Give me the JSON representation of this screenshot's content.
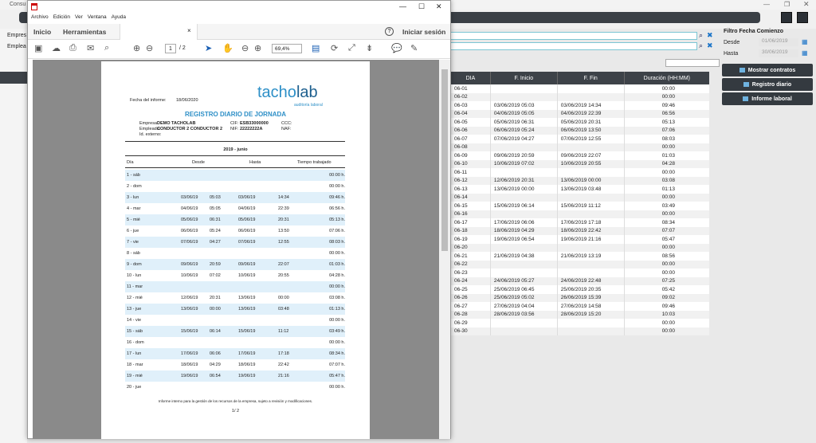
{
  "bg": {
    "title": "Consu",
    "label_empresa": "Empres",
    "label_empleado": "Emplea",
    "filter_title": "Filtro Fecha Comienzo",
    "desde_label": "Desde",
    "desde_value": "01/06/2019",
    "hasta_label": "Hasta",
    "hasta_value": "30/06/2019",
    "buttons": [
      "Mostrar contratos",
      "Registro diario",
      "Informe laboral"
    ],
    "grid_headers": [
      "DIA",
      "F. Inicio",
      "F. Fin",
      "Duración (HH:MM)"
    ],
    "grid_rows": [
      [
        "06-01",
        "",
        "",
        "00:00"
      ],
      [
        "06-02",
        "",
        "",
        "00:00"
      ],
      [
        "06-03",
        "03/06/2019 05:03",
        "03/06/2019 14:34",
        "09:46"
      ],
      [
        "06-04",
        "04/06/2019 05:05",
        "04/06/2019 22:39",
        "06:56"
      ],
      [
        "06-05",
        "05/06/2019 06:31",
        "05/06/2019 20:31",
        "05:13"
      ],
      [
        "06-06",
        "06/06/2019 05:24",
        "06/06/2019 13:50",
        "07:06"
      ],
      [
        "06-07",
        "07/06/2019 04:27",
        "07/06/2019 12:55",
        "08:03"
      ],
      [
        "06-08",
        "",
        "",
        "00:00"
      ],
      [
        "06-09",
        "09/06/2019 20:59",
        "09/06/2019 22:07",
        "01:03"
      ],
      [
        "06-10",
        "10/06/2019 07:02",
        "10/06/2019 20:55",
        "04:28"
      ],
      [
        "06-11",
        "",
        "",
        "00:00"
      ],
      [
        "06-12",
        "12/06/2019 20:31",
        "13/06/2019 00:00",
        "03:08"
      ],
      [
        "06-13",
        "13/06/2019 00:00",
        "13/06/2019 03:48",
        "01:13"
      ],
      [
        "06-14",
        "",
        "",
        "00:00"
      ],
      [
        "06-15",
        "15/06/2019 06:14",
        "15/06/2019 11:12",
        "03:49"
      ],
      [
        "06-16",
        "",
        "",
        "00:00"
      ],
      [
        "06-17",
        "17/06/2019 06:06",
        "17/06/2019 17:18",
        "08:34"
      ],
      [
        "06-18",
        "18/06/2019 04:29",
        "18/06/2019 22:42",
        "07:07"
      ],
      [
        "06-19",
        "19/06/2019 06:54",
        "19/06/2019 21:16",
        "05:47"
      ],
      [
        "06-20",
        "",
        "",
        "00:00"
      ],
      [
        "06-21",
        "21/06/2019 04:38",
        "21/06/2019 13:19",
        "08:56"
      ],
      [
        "06-22",
        "",
        "",
        "00:00"
      ],
      [
        "06-23",
        "",
        "",
        "00:00"
      ],
      [
        "06-24",
        "24/06/2019 05:27",
        "24/06/2019 22:48",
        "07:25"
      ],
      [
        "06-25",
        "25/06/2019 06:45",
        "25/06/2019 20:35",
        "05:42"
      ],
      [
        "06-26",
        "25/06/2019 05:02",
        "26/06/2019 15:39",
        "09:02"
      ],
      [
        "06-27",
        "27/06/2019 04:04",
        "27/06/2019 14:58",
        "09:46"
      ],
      [
        "06-28",
        "28/06/2019 03:56",
        "28/06/2019 15:20",
        "10:03"
      ],
      [
        "06-29",
        "",
        "",
        "00:00"
      ],
      [
        "06-30",
        "",
        "",
        "00:00"
      ]
    ]
  },
  "pdf": {
    "menu": [
      "Archivo",
      "Edición",
      "Ver",
      "Ventana",
      "Ayuda"
    ],
    "tabs": [
      "Inicio",
      "Herramientas"
    ],
    "signin": "Iniciar sesión",
    "page_current": "1",
    "page_total": "/ 2",
    "zoom": "69,4%",
    "doc": {
      "fecha_label": "Fecha del informe:",
      "fecha_value": "18/06/2020",
      "logo_a": "tacho",
      "logo_b": "lab",
      "logo_sub": "auditoría laboral",
      "title": "REGISTRO DIARIO DE JORNADA",
      "empresa_label": "Empresa:",
      "empresa_value": "DEMO TACHOLAB",
      "empleado_label": "Empleado:",
      "empleado_value": "CONDUCTOR 2 CONDUCTOR 2",
      "idext_label": "Id. externo:",
      "cif_label": "CIF:",
      "cif_value": "ESB33000000",
      "nif_label": "NIF:",
      "nif_value": "22222222A",
      "ccc_label": "CCC:",
      "naf_label": "NAF:",
      "period": "2019 - junio",
      "headers": [
        "Día",
        "Desde",
        "Hasta",
        "Tiempo trabajado"
      ],
      "rows": [
        [
          "1 - sáb",
          "",
          "",
          "",
          "",
          "00:00 h."
        ],
        [
          "2 - dom",
          "",
          "",
          "",
          "",
          "00:00 h."
        ],
        [
          "3 - lun",
          "03/06/19",
          "05:03",
          "03/06/19",
          "14:34",
          "09:46 h."
        ],
        [
          "4 - mar",
          "04/06/19",
          "05:05",
          "04/06/19",
          "22:39",
          "06:56 h."
        ],
        [
          "5 - mié",
          "05/06/19",
          "06:31",
          "05/06/19",
          "20:31",
          "05:13 h."
        ],
        [
          "6 - jue",
          "06/06/19",
          "05:24",
          "06/06/19",
          "13:50",
          "07:06 h."
        ],
        [
          "7 - vie",
          "07/06/19",
          "04:27",
          "07/06/19",
          "12:55",
          "08:03 h."
        ],
        [
          "8 - sáb",
          "",
          "",
          "",
          "",
          "00:00 h."
        ],
        [
          "9 - dom",
          "09/06/19",
          "20:59",
          "09/06/19",
          "22:07",
          "01:03 h."
        ],
        [
          "10 - lun",
          "10/06/19",
          "07:02",
          "10/06/19",
          "20:55",
          "04:28 h."
        ],
        [
          "11 - mar",
          "",
          "",
          "",
          "",
          "00:00 h."
        ],
        [
          "12 - mié",
          "12/06/19",
          "20:31",
          "13/06/19",
          "00:00",
          "03:08 h."
        ],
        [
          "13 - jue",
          "13/06/19",
          "00:00",
          "13/06/19",
          "03:48",
          "01:13 h."
        ],
        [
          "14 - vie",
          "",
          "",
          "",
          "",
          "00:00 h."
        ],
        [
          "15 - sáb",
          "15/06/19",
          "06:14",
          "15/06/19",
          "11:12",
          "03:49 h."
        ],
        [
          "16 - dom",
          "",
          "",
          "",
          "",
          "00:00 h."
        ],
        [
          "17 - lun",
          "17/06/19",
          "06:06",
          "17/06/19",
          "17:18",
          "08:34 h."
        ],
        [
          "18 - mar",
          "18/06/19",
          "04:29",
          "18/06/19",
          "22:42",
          "07:07 h."
        ],
        [
          "19 - mié",
          "19/06/19",
          "06:54",
          "19/06/19",
          "21:16",
          "05:47 h."
        ],
        [
          "20 - jue",
          "",
          "",
          "",
          "",
          "00:00 h."
        ]
      ],
      "footer": "Informe interno para la gestión de los recursos de la empresa, sujeto a revisión y modificaciones.",
      "page": "1/ 2"
    }
  }
}
